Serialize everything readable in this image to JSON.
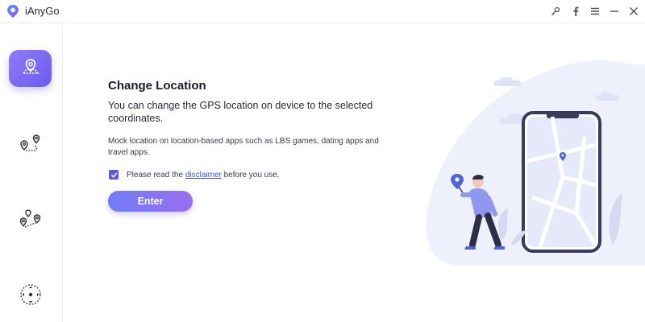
{
  "app": {
    "title": "iAnyGo"
  },
  "window_controls": [
    {
      "name": "key-icon"
    },
    {
      "name": "facebook-icon"
    },
    {
      "name": "menu-icon"
    },
    {
      "name": "minimize-icon"
    },
    {
      "name": "close-icon"
    }
  ],
  "sidebar": {
    "items": [
      {
        "name": "change-location",
        "icon": "map-pin-icon",
        "active": true
      },
      {
        "name": "single-spot-movement",
        "icon": "two-pins-route-icon",
        "active": false
      },
      {
        "name": "multi-spot-movement",
        "icon": "multi-pins-route-icon",
        "active": false
      },
      {
        "name": "joystick-movement",
        "icon": "joystick-icon",
        "active": false
      }
    ]
  },
  "main": {
    "title": "Change Location",
    "description": "You can change the GPS location on device to the selected coordinates.",
    "note": "Mock location on location-based apps such as LBS games, dating apps and travel apps.",
    "consent": {
      "checked": true,
      "prefix": "Please read the ",
      "link_text": "disclaimer",
      "suffix": " before you use."
    },
    "enter_label": "Enter"
  },
  "colors": {
    "accent": "#6a5bf0",
    "link": "#3b52c8",
    "illustration_bg": "#eef0fb"
  }
}
